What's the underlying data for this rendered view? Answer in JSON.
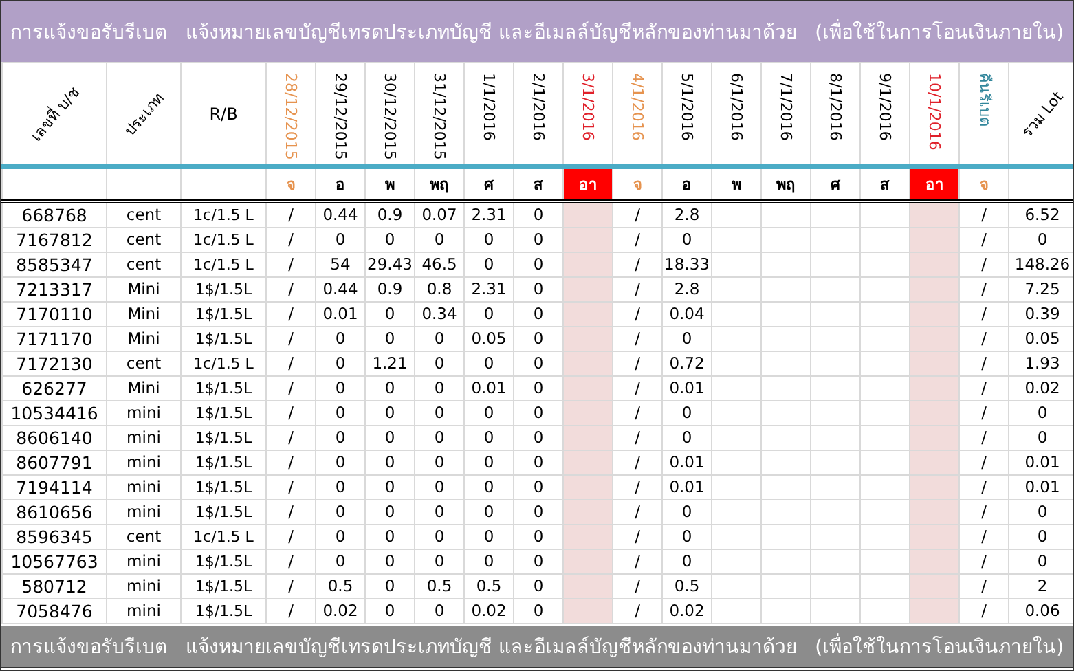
{
  "title": "การแจ้งขอรับรีเบต   แจ้งหมายเลขบัญชีเทรดประเภทบัญชี และอีเมลล์บัญชีหลักของท่านมาด้วย   (เพื่อใช้ในการโอนเงินภายใน)",
  "columns": {
    "account": "เลขที่ บ/ช",
    "type": "ประเภท",
    "rb": "R/B",
    "rebate": {
      "label": "คืนรีเบต",
      "weekday": "จ"
    },
    "total": "รวม Lot"
  },
  "date_columns": [
    {
      "date": "28/12/2015",
      "weekday": "จ",
      "kind": "monday"
    },
    {
      "date": "29/12/2015",
      "weekday": "อ",
      "kind": "weekday"
    },
    {
      "date": "30/12/2015",
      "weekday": "พ",
      "kind": "weekday"
    },
    {
      "date": "31/12/2015",
      "weekday": "พฤ",
      "kind": "weekday"
    },
    {
      "date": "1/1/2016",
      "weekday": "ศ",
      "kind": "weekday"
    },
    {
      "date": "2/1/2016",
      "weekday": "ส",
      "kind": "weekday"
    },
    {
      "date": "3/1/2016",
      "weekday": "อา",
      "kind": "sunday"
    },
    {
      "date": "4/1/2016",
      "weekday": "จ",
      "kind": "monday"
    },
    {
      "date": "5/1/2016",
      "weekday": "อ",
      "kind": "weekday"
    },
    {
      "date": "6/1/2016",
      "weekday": "พ",
      "kind": "weekday"
    },
    {
      "date": "7/1/2016",
      "weekday": "พฤ",
      "kind": "weekday"
    },
    {
      "date": "8/1/2016",
      "weekday": "ศ",
      "kind": "weekday"
    },
    {
      "date": "9/1/2016",
      "weekday": "ส",
      "kind": "weekday"
    },
    {
      "date": "10/1/2016",
      "weekday": "อา",
      "kind": "sunday"
    }
  ],
  "rows": [
    {
      "account": "668768",
      "type": "cent",
      "rb": "1c/1.5 L",
      "values": [
        "/",
        "0.44",
        "0.9",
        "0.07",
        "2.31",
        "0",
        "/",
        "2.8"
      ],
      "rebate": "/",
      "total": "6.52"
    },
    {
      "account": "7167812",
      "type": "cent",
      "rb": "1c/1.5 L",
      "values": [
        "/",
        "0",
        "0",
        "0",
        "0",
        "0",
        "/",
        "0"
      ],
      "rebate": "/",
      "total": "0"
    },
    {
      "account": "8585347",
      "type": "cent",
      "rb": "1c/1.5 L",
      "values": [
        "/",
        "54",
        "29.43",
        "46.5",
        "0",
        "0",
        "/",
        "18.33"
      ],
      "rebate": "/",
      "total": "148.26"
    },
    {
      "account": "7213317",
      "type": "Mini",
      "rb": "1$/1.5L",
      "values": [
        "/",
        "0.44",
        "0.9",
        "0.8",
        "2.31",
        "0",
        "/",
        "2.8"
      ],
      "rebate": "/",
      "total": "7.25"
    },
    {
      "account": "7170110",
      "type": "Mini",
      "rb": "1$/1.5L",
      "values": [
        "/",
        "0.01",
        "0",
        "0.34",
        "0",
        "0",
        "/",
        "0.04"
      ],
      "rebate": "/",
      "total": "0.39"
    },
    {
      "account": "7171170",
      "type": "Mini",
      "rb": "1$/1.5L",
      "values": [
        "/",
        "0",
        "0",
        "0",
        "0.05",
        "0",
        "/",
        "0"
      ],
      "rebate": "/",
      "total": "0.05"
    },
    {
      "account": "7172130",
      "type": "cent",
      "rb": "1c/1.5 L",
      "values": [
        "/",
        "0",
        "1.21",
        "0",
        "0",
        "0",
        "/",
        "0.72"
      ],
      "rebate": "/",
      "total": "1.93"
    },
    {
      "account": "626277",
      "type": "Mini",
      "rb": "1$/1.5L",
      "values": [
        "/",
        "0",
        "0",
        "0",
        "0.01",
        "0",
        "/",
        "0.01"
      ],
      "rebate": "/",
      "total": "0.02"
    },
    {
      "account": "10534416",
      "type": "mini",
      "rb": "1$/1.5L",
      "values": [
        "/",
        "0",
        "0",
        "0",
        "0",
        "0",
        "/",
        "0"
      ],
      "rebate": "/",
      "total": "0"
    },
    {
      "account": "8606140",
      "type": "mini",
      "rb": "1$/1.5L",
      "values": [
        "/",
        "0",
        "0",
        "0",
        "0",
        "0",
        "/",
        "0"
      ],
      "rebate": "/",
      "total": "0"
    },
    {
      "account": "8607791",
      "type": "mini",
      "rb": "1$/1.5L",
      "values": [
        "/",
        "0",
        "0",
        "0",
        "0",
        "0",
        "/",
        "0.01"
      ],
      "rebate": "/",
      "total": "0.01"
    },
    {
      "account": "7194114",
      "type": "mini",
      "rb": "1$/1.5L",
      "values": [
        "/",
        "0",
        "0",
        "0",
        "0",
        "0",
        "/",
        "0.01"
      ],
      "rebate": "/",
      "total": "0.01"
    },
    {
      "account": "8610656",
      "type": "mini",
      "rb": "1$/1.5L",
      "values": [
        "/",
        "0",
        "0",
        "0",
        "0",
        "0",
        "/",
        "0"
      ],
      "rebate": "/",
      "total": "0"
    },
    {
      "account": "8596345",
      "type": "cent",
      "rb": "1c/1.5 L",
      "values": [
        "/",
        "0",
        "0",
        "0",
        "0",
        "0",
        "/",
        "0"
      ],
      "rebate": "/",
      "total": "0"
    },
    {
      "account": "10567763",
      "type": "mini",
      "rb": "1$/1.5L",
      "values": [
        "/",
        "0",
        "0",
        "0",
        "0",
        "0",
        "/",
        "0"
      ],
      "rebate": "/",
      "total": "0"
    },
    {
      "account": "580712",
      "type": "mini",
      "rb": "1$/1.5L",
      "values": [
        "/",
        "0.5",
        "0",
        "0.5",
        "0.5",
        "0",
        "/",
        "0.5"
      ],
      "rebate": "/",
      "total": "2"
    },
    {
      "account": "7058476",
      "type": "mini",
      "rb": "1$/1.5L",
      "values": [
        "/",
        "0.02",
        "0",
        "0",
        "0.02",
        "0",
        "/",
        "0.02"
      ],
      "rebate": "/",
      "total": "0.06"
    }
  ],
  "footer": "การแจ้งขอรับรีเบต   แจ้งหมายเลขบัญชีเทรดประเภทบัญชี และอีเมลล์บัญชีหลักของท่านมาด้วย   (เพื่อใช้ในการโอนเงินภายใน)"
}
